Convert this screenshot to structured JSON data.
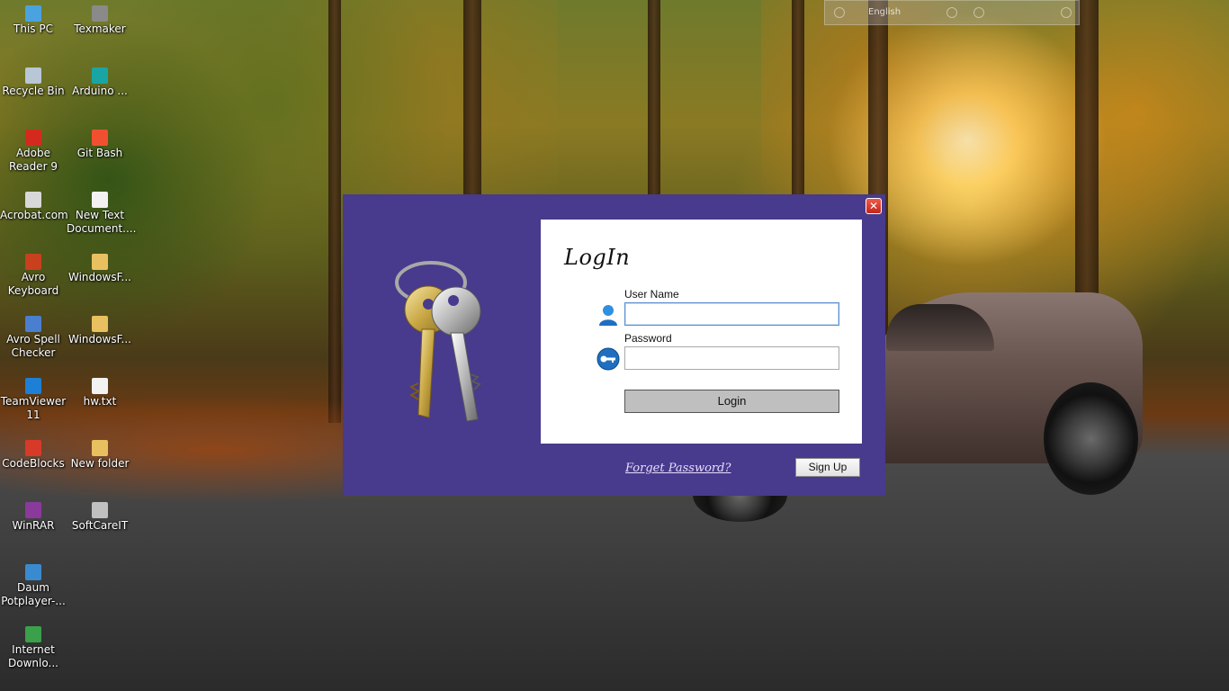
{
  "desktop": {
    "icons": [
      {
        "label": "This PC",
        "color": "#4aa3df"
      },
      {
        "label": "Texmaker",
        "color": "#8a8a8a"
      },
      {
        "label": "Recycle Bin",
        "color": "#b8c6d6"
      },
      {
        "label": "Arduino ...",
        "color": "#1aa5a5"
      },
      {
        "label": "Adobe Reader 9",
        "color": "#d42a1e"
      },
      {
        "label": "Git Bash",
        "color": "#f05030"
      },
      {
        "label": "Acrobat.com",
        "color": "#d8d8d8"
      },
      {
        "label": "New Text Document....",
        "color": "#f2f2f2"
      },
      {
        "label": "Avro Keyboard",
        "color": "#c8401e"
      },
      {
        "label": "WindowsF...",
        "color": "#e8c060"
      },
      {
        "label": "Avro Spell Checker",
        "color": "#4a7fd0"
      },
      {
        "label": "WindowsF...",
        "color": "#e8c060"
      },
      {
        "label": "TeamViewer 11",
        "color": "#1e7fd6"
      },
      {
        "label": "hw.txt",
        "color": "#f2f2f2"
      },
      {
        "label": "CodeBlocks",
        "color": "#d83a2a"
      },
      {
        "label": "New folder",
        "color": "#e8c060"
      },
      {
        "label": "WinRAR",
        "color": "#8a3a9a"
      },
      {
        "label": "SoftCareIT",
        "color": "#c0c0c0"
      },
      {
        "label": "Daum Potplayer-...",
        "color": "#3a8ad0"
      },
      {
        "label": "Internet Downlo...",
        "color": "#3aa04a"
      }
    ]
  },
  "language_bar": {
    "label": "English"
  },
  "dialog": {
    "close_label": "✕",
    "title": "LogIn",
    "username_label": "User Name",
    "username_value": "",
    "password_label": "Password",
    "password_value": "",
    "login_button": "Login",
    "forget_link": "Forget Password?",
    "signup_button": "Sign Up",
    "colors": {
      "frame": "#483a8c",
      "panel": "#ffffff",
      "button": "#bfbfbf"
    }
  }
}
